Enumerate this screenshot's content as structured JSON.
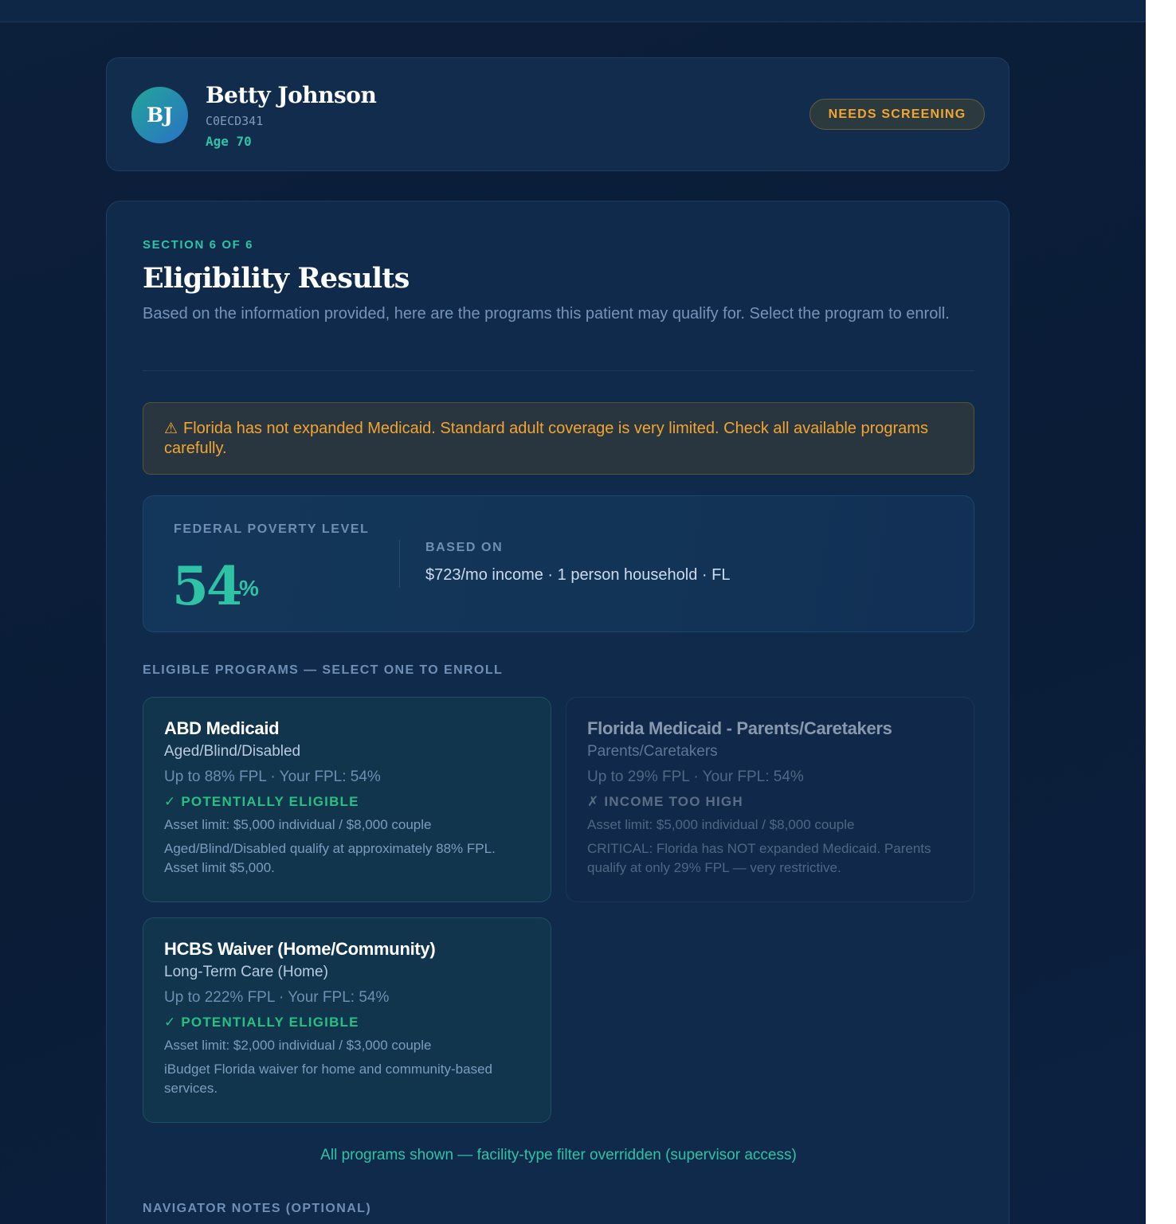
{
  "patient": {
    "initials": "BJ",
    "name": "Betty Johnson",
    "id": "C0ECD341",
    "age": "Age 70",
    "status": "NEEDS SCREENING"
  },
  "section": {
    "eyebrow": "SECTION 6 OF 6",
    "title": "Eligibility Results",
    "description": "Based on the information provided, here are the programs this patient may qualify for. Select the program to enroll."
  },
  "warning": {
    "icon": "warning-triangle-icon",
    "text": "Florida has not expanded Medicaid. Standard adult coverage is very limited. Check all available programs carefully."
  },
  "fpl": {
    "label": "FEDERAL POVERTY LEVEL",
    "value": "54",
    "unit": "%",
    "based_label": "BASED ON",
    "based_value": "$723/mo income · 1 person household · FL"
  },
  "programs_heading": "ELIGIBLE PROGRAMS — SELECT ONE TO ENROLL",
  "programs": [
    {
      "name": "ABD Medicaid",
      "category": "Aged/Blind/Disabled",
      "fpl_line": "Up to 88% FPL · Your FPL: 54%",
      "status": "✓ POTENTIALLY ELIGIBLE",
      "asset": "Asset limit: $5,000 individual / $8,000 couple",
      "note": "Aged/Blind/Disabled qualify at approximately 88% FPL. Asset limit $5,000."
    },
    {
      "name": "Florida Medicaid - Parents/Caretakers",
      "category": "Parents/Caretakers",
      "fpl_line": "Up to 29% FPL · Your FPL: 54%",
      "status": "✗ INCOME TOO HIGH",
      "asset": "Asset limit: $5,000 individual / $8,000 couple",
      "note": "CRITICAL: Florida has NOT expanded Medicaid. Parents qualify at only 29% FPL — very restrictive."
    },
    {
      "name": "HCBS Waiver (Home/Community)",
      "category": "Long-Term Care (Home)",
      "fpl_line": "Up to 222% FPL · Your FPL: 54%",
      "status": "✓ POTENTIALLY ELIGIBLE",
      "asset": "Asset limit: $2,000 individual / $3,000 couple",
      "note": "iBudget Florida waiver for home and community-based services."
    }
  ],
  "override_note": "All programs shown — facility-type filter overridden (supervisor access)",
  "notes_heading": "NAVIGATOR NOTES (OPTIONAL)",
  "colors": {
    "accent_teal": "#2ec3a5",
    "warning_amber": "#f3a52f",
    "eligible_green": "#26c083",
    "background": "#0c1f3b"
  }
}
